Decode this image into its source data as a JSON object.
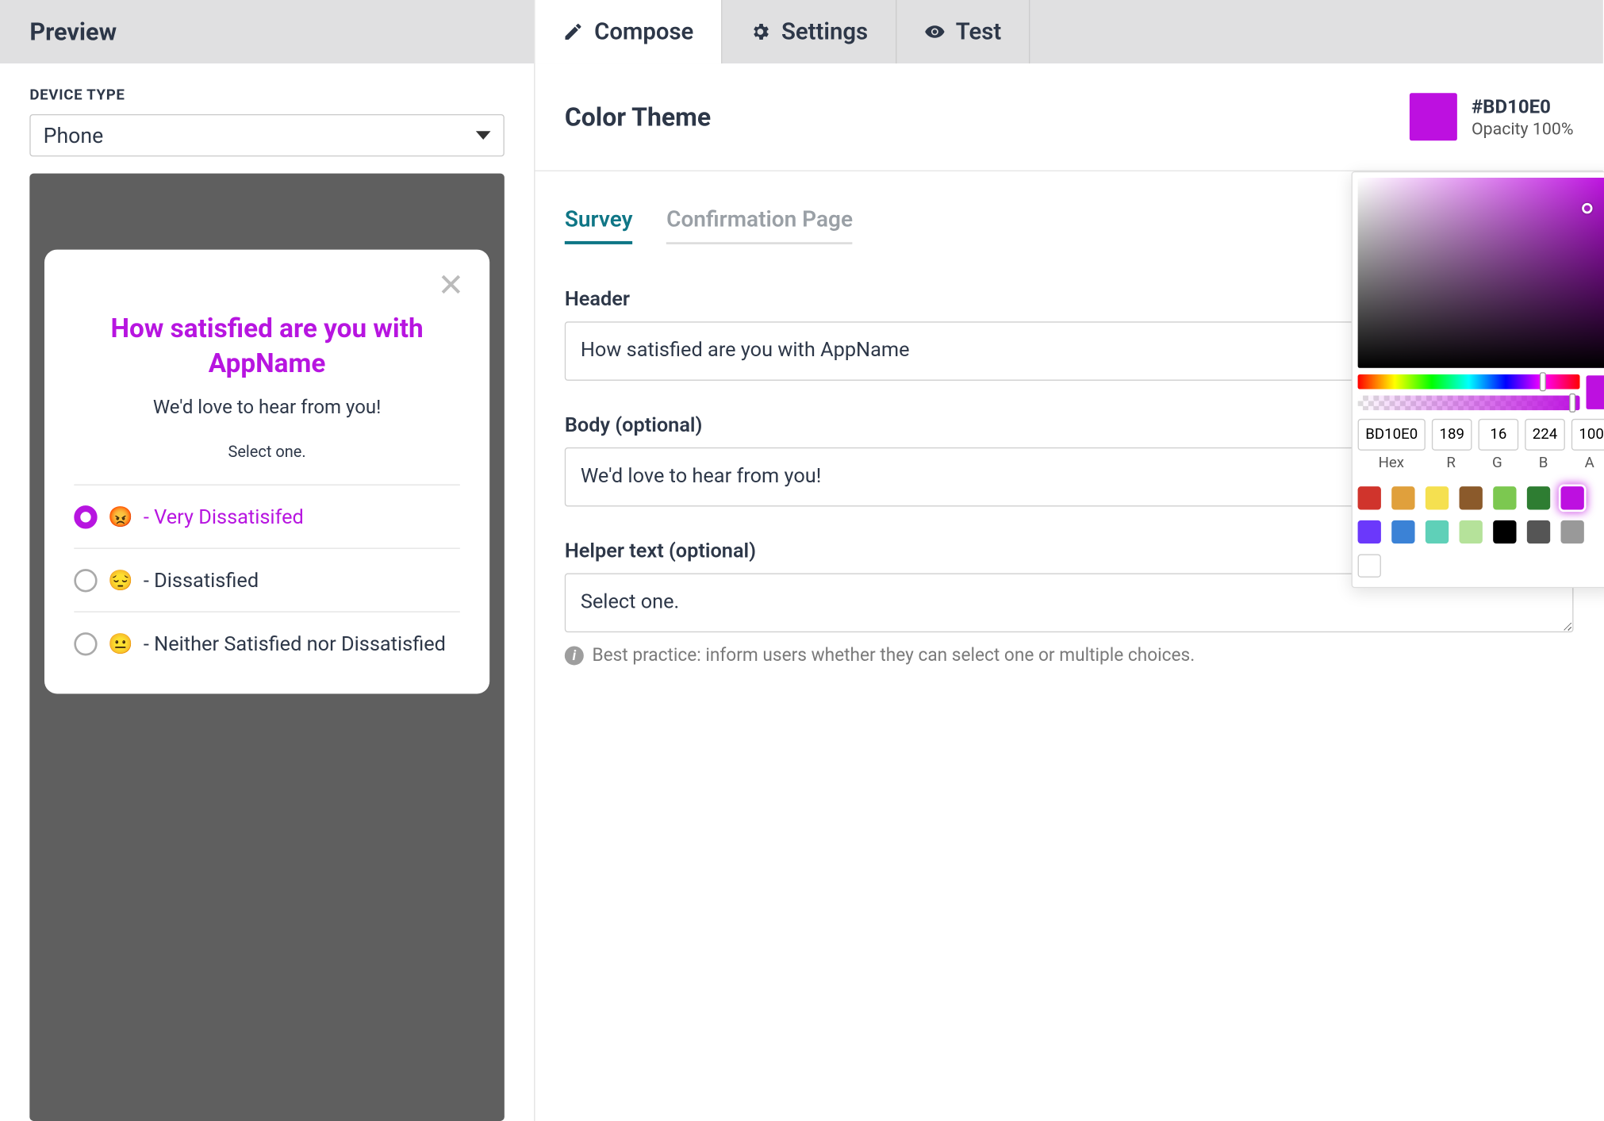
{
  "preview": {
    "title": "Preview",
    "device_type_label": "DEVICE TYPE",
    "device_type_value": "Phone"
  },
  "survey_preview": {
    "title": "How satisfied are you with AppName",
    "body": "We'd love to hear from you!",
    "helper": "Select one.",
    "options": [
      {
        "emoji": "😡",
        "label": "- Very Dissatisifed",
        "selected": true
      },
      {
        "emoji": "😔",
        "label": "- Dissatisfied",
        "selected": false
      },
      {
        "emoji": "😐",
        "label": "- Neither Satisfied nor Dissatisfied",
        "selected": false
      }
    ]
  },
  "tabs": {
    "compose": "Compose",
    "settings": "Settings",
    "test": "Test"
  },
  "color_theme": {
    "title": "Color Theme",
    "hex": "#BD10E0",
    "opacity": "Opacity 100%"
  },
  "subtabs": {
    "survey": "Survey",
    "confirmation": "Confirmation Page"
  },
  "form": {
    "header_label": "Header",
    "header_value": "How satisfied are you with AppName",
    "body_label": "Body (optional)",
    "body_value": "We'd love to hear from you!",
    "helper_label": "Helper text (optional)",
    "helper_value": "Select one.",
    "best_practice": "Best practice: inform users whether they can select one or multiple choices."
  },
  "picker": {
    "hex": "BD10E0",
    "r": "189",
    "g": "16",
    "b": "224",
    "a": "100",
    "hex_label": "Hex",
    "r_label": "R",
    "g_label": "G",
    "b_label": "B",
    "a_label": "A",
    "swatches": [
      "#d0342c",
      "#e0a03c",
      "#f5e050",
      "#8b5a2b",
      "#7cc850",
      "#2e7d32",
      "#bd10e0",
      "#6b38fb",
      "#3b82d6",
      "#5fd0b8",
      "#b5e29a",
      "#000000",
      "#555555",
      "#999999",
      "#ffffff"
    ]
  }
}
